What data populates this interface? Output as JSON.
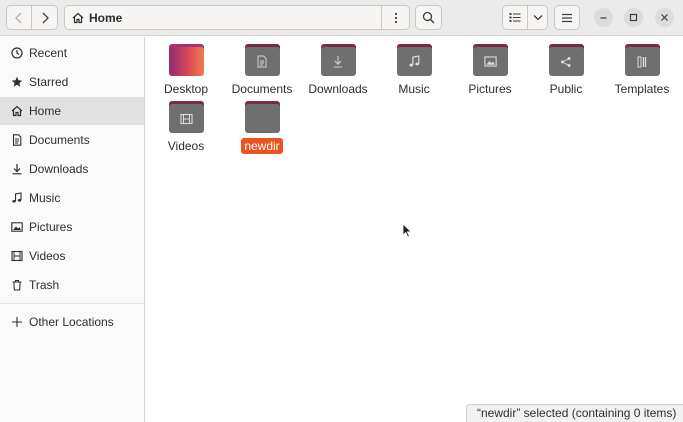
{
  "header": {
    "path_label": "Home",
    "back_icon": "chevron-left-icon",
    "forward_icon": "chevron-right-icon",
    "path_menu_icon": "vertical-dots-icon",
    "search_icon": "search-icon",
    "view_list_icon": "list-view-icon",
    "view_dropdown_icon": "chevron-down-icon",
    "menu_icon": "hamburger-icon",
    "window_controls": [
      "minimize-icon",
      "maximize-icon",
      "close-icon"
    ]
  },
  "sidebar": {
    "items": [
      {
        "label": "Recent",
        "icon": "clock-icon"
      },
      {
        "label": "Starred",
        "icon": "star-icon"
      },
      {
        "label": "Home",
        "icon": "home-icon",
        "active": true
      },
      {
        "label": "Documents",
        "icon": "document-icon"
      },
      {
        "label": "Downloads",
        "icon": "download-icon"
      },
      {
        "label": "Music",
        "icon": "music-icon"
      },
      {
        "label": "Pictures",
        "icon": "picture-icon"
      },
      {
        "label": "Videos",
        "icon": "film-icon"
      },
      {
        "label": "Trash",
        "icon": "trash-icon"
      },
      {
        "label": "Other Locations",
        "icon": "plus-icon"
      }
    ]
  },
  "files": [
    {
      "label": "Desktop",
      "icon": "desktop-folder-icon"
    },
    {
      "label": "Documents",
      "icon": "documents-folder-icon"
    },
    {
      "label": "Downloads",
      "icon": "downloads-folder-icon"
    },
    {
      "label": "Music",
      "icon": "music-folder-icon"
    },
    {
      "label": "Pictures",
      "icon": "pictures-folder-icon"
    },
    {
      "label": "Public",
      "icon": "public-folder-icon"
    },
    {
      "label": "Templates",
      "icon": "templates-folder-icon"
    },
    {
      "label": "Videos",
      "icon": "videos-folder-icon"
    },
    {
      "label": "newdir",
      "icon": "folder-icon",
      "selected": true
    }
  ],
  "status": {
    "text": "“newdir” selected  (containing 0 items)"
  },
  "colors": {
    "accent": "#e95420",
    "folder_tab": "#7a2a43",
    "folder_body": "#706f6f"
  }
}
